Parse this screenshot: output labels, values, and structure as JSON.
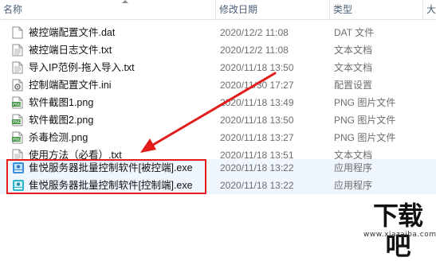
{
  "columns": {
    "name": "名称",
    "date": "修改日期",
    "type": "类型",
    "size": "大"
  },
  "files": [
    {
      "name": "被控端配置文件.dat",
      "date": "2020/12/2 11:08",
      "type": "DAT 文件",
      "icon": "document-icon"
    },
    {
      "name": "被控端日志文件.txt",
      "date": "2020/12/2 11:08",
      "type": "文本文档",
      "icon": "text-file-icon"
    },
    {
      "name": "导入IP范例-拖入导入.txt",
      "date": "2020/11/18 13:50",
      "type": "文本文档",
      "icon": "text-file-icon"
    },
    {
      "name": "控制端配置文件.ini",
      "date": "2020/11/30 17:27",
      "type": "配置设置",
      "icon": "settings-file-icon"
    },
    {
      "name": "软件截图1.png",
      "date": "2020/11/18 13:49",
      "type": "PNG 图片文件",
      "icon": "png-file-icon"
    },
    {
      "name": "软件截图2.png",
      "date": "2020/11/18 13:50",
      "type": "PNG 图片文件",
      "icon": "png-file-icon"
    },
    {
      "name": "杀毒检测.png",
      "date": "2020/11/18 13:27",
      "type": "PNG 图片文件",
      "icon": "png-file-icon"
    },
    {
      "name": "使用方法（必看）.txt",
      "date": "2020/11/18 13:51",
      "type": "文本文档",
      "icon": "text-file-icon"
    },
    {
      "name": "隹悦服务器批量控制软件[被控端].exe",
      "date": "2020/11/18 13:22",
      "type": "应用程序",
      "icon": "app-icon"
    },
    {
      "name": "隹悦服务器批量控制软件[控制端].exe",
      "date": "2020/11/18 13:22",
      "type": "应用程序",
      "icon": "app-icon"
    }
  ],
  "watermark": {
    "title": "下载吧",
    "url": "www.xiazaiba.com"
  },
  "colors": {
    "highlight": "#e31b1b",
    "header_text": "#4c607a",
    "selection": "#f0f6fd"
  }
}
